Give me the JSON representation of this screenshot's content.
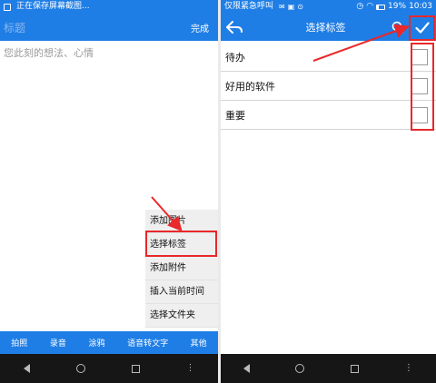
{
  "left": {
    "status_text": "正在保存屏幕截图...",
    "title_placeholder": "标题",
    "done_label": "完成",
    "body_placeholder": "您此刻的想法、心情",
    "menu_items": [
      "添加图片",
      "选择标签",
      "添加附件",
      "插入当前时间",
      "选择文件夹"
    ],
    "bottom_tabs": [
      "拍照",
      "录音",
      "涂鸦",
      "语音转文字",
      "其他"
    ]
  },
  "right": {
    "carrier": "仅限紧急呼叫",
    "battery": "19%",
    "time": "10:03",
    "title": "选择标签",
    "tags": [
      "待办",
      "好用的软件",
      "重要"
    ]
  },
  "colors": {
    "accent": "#1f7ee6",
    "annotation": "#e8282a",
    "navbar": "#161616"
  }
}
